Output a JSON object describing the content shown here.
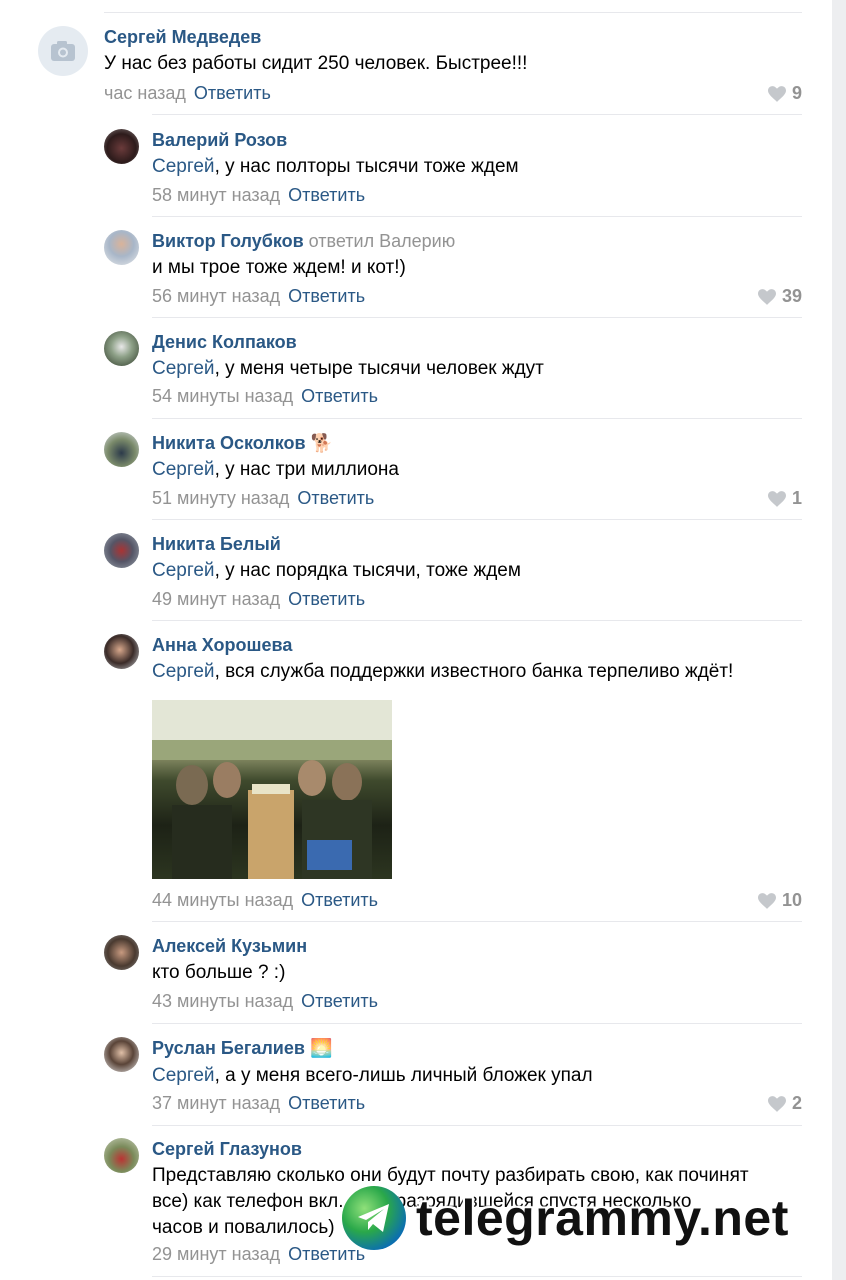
{
  "comments": [
    {
      "author": "Сергей Медведев",
      "mention": "",
      "text": "У нас без работы сидит 250 человек. Быстрее!!!",
      "time": "час назад",
      "reply_label": "Ответить",
      "likes": "9"
    },
    {
      "author": "Валерий Розов",
      "mention": "Сергей",
      "text": ", у нас полторы тысячи тоже ждем",
      "time": "58 минут назад",
      "reply_label": "Ответить",
      "likes": ""
    },
    {
      "author": "Виктор Голубков",
      "reply_to": "ответил Валерию",
      "mention": "",
      "text": "и мы трое тоже ждем! и кот!)",
      "time": "56 минут назад",
      "reply_label": "Ответить",
      "likes": "39"
    },
    {
      "author": "Денис Колпаков",
      "mention": "Сергей",
      "text": ", у меня четыре тысячи человек ждут",
      "time": "54 минуты назад",
      "reply_label": "Ответить",
      "likes": ""
    },
    {
      "author": "Никита Осколков",
      "author_emoji": "🐕",
      "mention": "Сергей",
      "text": ", у нас три миллиона",
      "time": "51 минуту назад",
      "reply_label": "Ответить",
      "likes": "1"
    },
    {
      "author": "Никита Белый",
      "mention": "Сергей",
      "text": ", у нас порядка тысячи, тоже ждем",
      "time": "49 минут назад",
      "reply_label": "Ответить",
      "likes": ""
    },
    {
      "author": "Анна Хорошева",
      "mention": "Сергей",
      "text": ", вся служба поддержки известного банка терпеливо ждёт!",
      "time": "44 минуты назад",
      "reply_label": "Ответить",
      "likes": "10"
    },
    {
      "author": "Алексей Кузьмин",
      "mention": "",
      "text": "кто больше ? :)",
      "time": "43 минуты назад",
      "reply_label": "Ответить",
      "likes": ""
    },
    {
      "author": "Руслан Бегалиев",
      "author_emoji": "🌅",
      "mention": "Сергей",
      "text": ", а у меня всего-лишь личный бложек упал",
      "time": "37 минут назад",
      "reply_label": "Ответить",
      "likes": "2"
    },
    {
      "author": "Сергей Глазунов",
      "mention": "",
      "text_lines": [
        "Представляю сколько они будут почту разбирать свою, как починят",
        "все) как телефон вкл... ш... разрядившейся спустя несколько",
        "часов и повалилось)"
      ],
      "time": "29 минут назад",
      "reply_label": "Ответить",
      "likes": ""
    }
  ],
  "watermark": {
    "text": "telegrammy.net",
    "icon": "telegram-plane-icon"
  },
  "colors": {
    "link": "#2a5885",
    "muted": "#939393",
    "divider": "#e7e8ec",
    "background": "#edeef0"
  }
}
